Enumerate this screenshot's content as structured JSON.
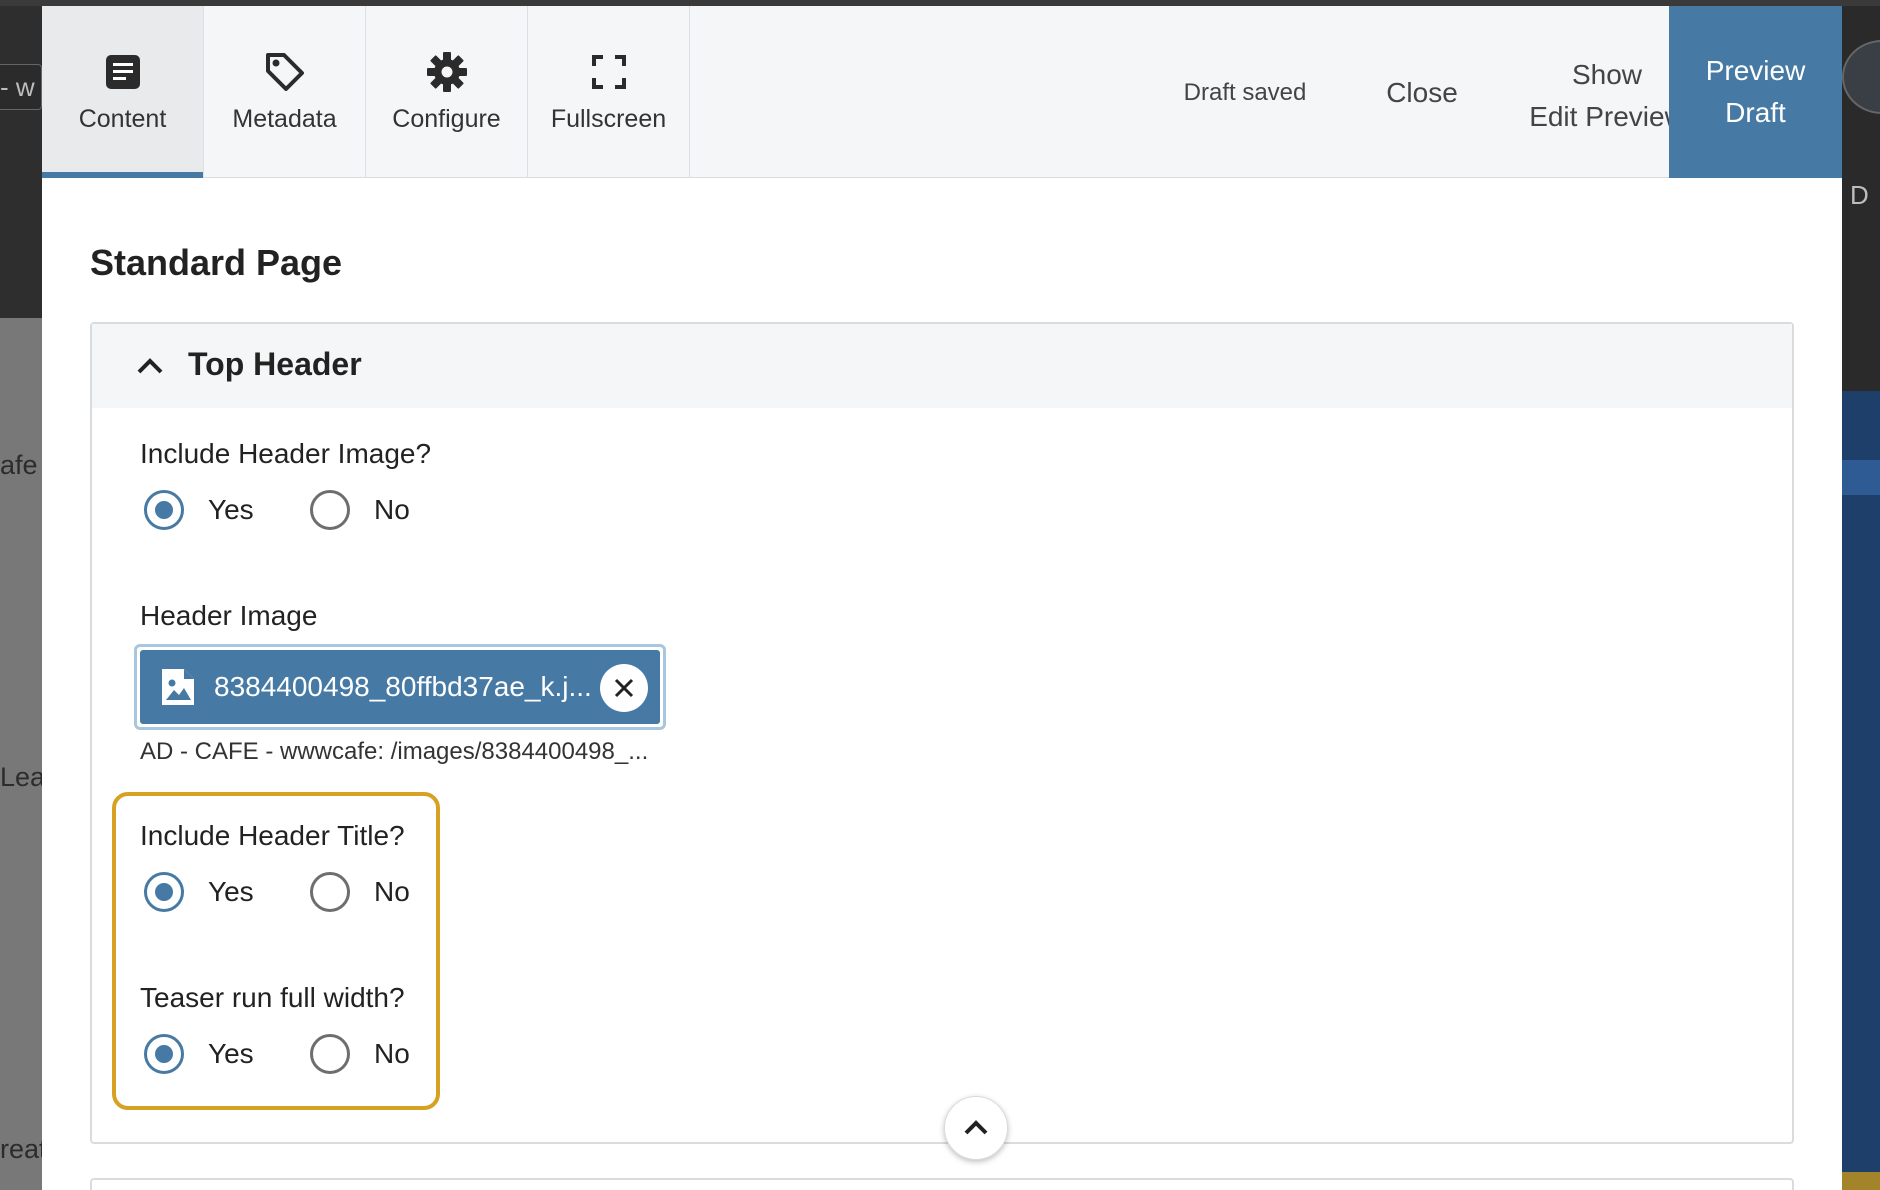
{
  "background": {
    "left_pill_text": "- w",
    "left_texts": [
      "afe",
      "Lea",
      "reat"
    ],
    "right_text": "D"
  },
  "toolbar": {
    "tabs": [
      {
        "label": "Content",
        "icon": "document-icon",
        "active": true
      },
      {
        "label": "Metadata",
        "icon": "tag-icon",
        "active": false
      },
      {
        "label": "Configure",
        "icon": "gear-icon",
        "active": false
      },
      {
        "label": "Fullscreen",
        "icon": "fullscreen-icon",
        "active": false
      }
    ],
    "status": "Draft saved",
    "close_label": "Close",
    "show_edit_preview_line1": "Show",
    "show_edit_preview_line2": "Edit Preview",
    "preview_line1": "Preview",
    "preview_line2": "Draft"
  },
  "page": {
    "title": "Standard Page",
    "section": {
      "title": "Top Header",
      "expanded": true,
      "include_header_image": {
        "label": "Include Header Image?",
        "options": [
          "Yes",
          "No"
        ],
        "selected": "Yes"
      },
      "header_image": {
        "label": "Header Image",
        "file_name": "8384400498_80ffbd37ae_k.j...",
        "path": "AD - CAFE - wwwcafe: /images/8384400498_..."
      },
      "include_header_title": {
        "label": "Include Header Title?",
        "options": [
          "Yes",
          "No"
        ],
        "selected": "Yes"
      },
      "teaser_full_width": {
        "label": "Teaser run full width?",
        "options": [
          "Yes",
          "No"
        ],
        "selected": "Yes"
      }
    }
  },
  "colors": {
    "accent": "#467aa5",
    "highlight": "#d7a123"
  }
}
